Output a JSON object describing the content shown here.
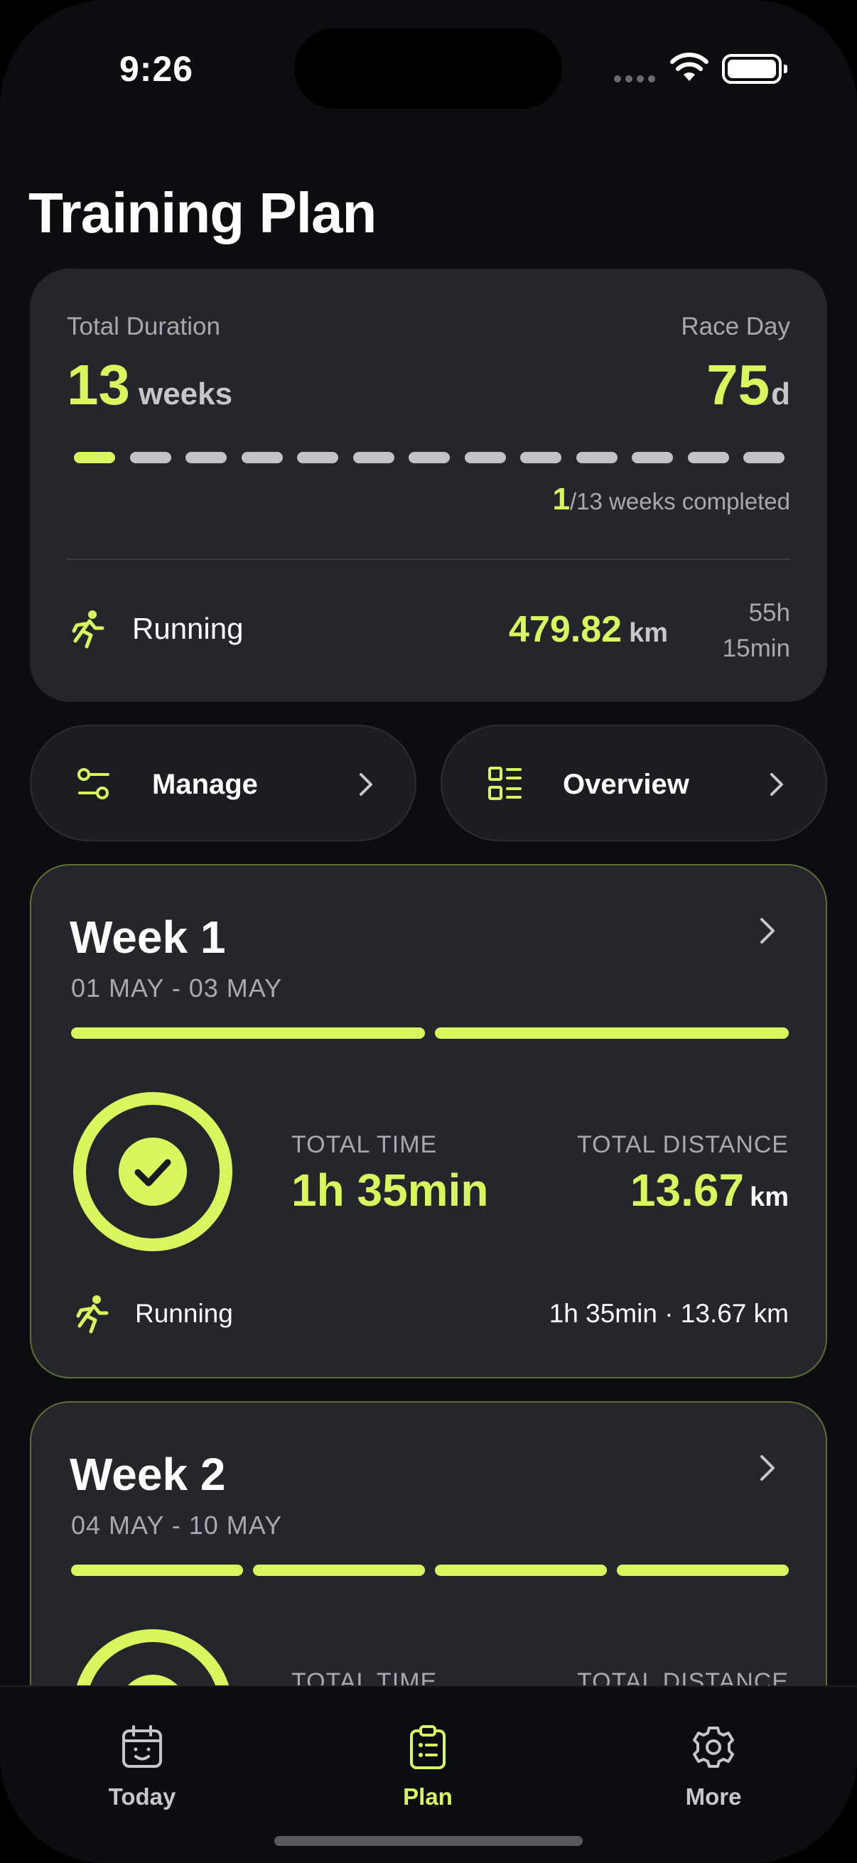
{
  "status_bar": {
    "time": "9:26"
  },
  "page": {
    "title": "Training Plan"
  },
  "summary": {
    "duration_label": "Total Duration",
    "duration_value": "13",
    "duration_unit": "weeks",
    "race_label": "Race Day",
    "race_value": "75",
    "race_unit": "d",
    "weeks_total": 13,
    "weeks_done": 1,
    "completed_count": "1",
    "completed_text": "/13 weeks completed",
    "sport": "Running",
    "distance_value": "479.82",
    "distance_unit": "km",
    "time_line1": "55h",
    "time_line2": "15min"
  },
  "actions": {
    "manage_label": "Manage",
    "overview_label": "Overview"
  },
  "weeks": [
    {
      "title": "Week 1",
      "dates": "01 MAY - 03 MAY",
      "segments": 2,
      "total_time_label": "TOTAL TIME",
      "total_time": "1h 35min",
      "total_distance_label": "TOTAL DISTANCE",
      "total_distance": "13.67",
      "distance_unit": "km",
      "sport": "Running",
      "sport_summary": "1h 35min · 13.67 km"
    },
    {
      "title": "Week 2",
      "dates": "04 MAY - 10 MAY",
      "segments": 4,
      "total_time_label": "TOTAL TIME",
      "total_distance_label": "TOTAL DISTANCE"
    }
  ],
  "tabs": [
    {
      "label": "Today",
      "icon": "calendar-smile-icon"
    },
    {
      "label": "Plan",
      "icon": "clipboard-icon"
    },
    {
      "label": "More",
      "icon": "gear-icon"
    }
  ],
  "colors": {
    "accent": "#d8f65e",
    "background": "#0c0d11",
    "card": "#25262c"
  }
}
